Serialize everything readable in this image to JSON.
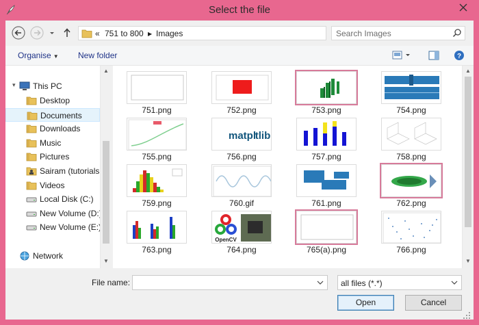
{
  "window": {
    "title": "Select the file"
  },
  "address": {
    "prefix": "«",
    "crumbs": [
      "751 to 800",
      "Images"
    ]
  },
  "search": {
    "placeholder": "Search Images"
  },
  "toolbar": {
    "organise": "Organise",
    "new_folder": "New folder"
  },
  "sidebar": {
    "items": [
      {
        "label": "This PC",
        "icon": "computer-icon",
        "level": 0
      },
      {
        "label": "Desktop",
        "icon": "folder-icon",
        "level": 1
      },
      {
        "label": "Documents",
        "icon": "folder-icon",
        "level": 1,
        "selected": true
      },
      {
        "label": "Downloads",
        "icon": "folder-icon",
        "level": 1
      },
      {
        "label": "Music",
        "icon": "folder-icon",
        "level": 1
      },
      {
        "label": "Pictures",
        "icon": "folder-icon",
        "level": 1
      },
      {
        "label": "Sairam (tutorialsp",
        "icon": "user-folder-icon",
        "level": 1
      },
      {
        "label": "Videos",
        "icon": "folder-icon",
        "level": 1
      },
      {
        "label": "Local Disk (C:)",
        "icon": "drive-icon",
        "level": 1
      },
      {
        "label": "New Volume (D:)",
        "icon": "drive-icon",
        "level": 1
      },
      {
        "label": "New Volume (E:)",
        "icon": "drive-icon",
        "level": 1
      },
      {
        "label": "Network",
        "icon": "network-icon",
        "level": 0
      }
    ]
  },
  "files": [
    {
      "name": "751.png",
      "thumb": "blank-plot"
    },
    {
      "name": "752.png",
      "thumb": "red-square"
    },
    {
      "name": "753.png",
      "thumb": "3d-bars",
      "selected": true
    },
    {
      "name": "754.png",
      "thumb": "blue-panels"
    },
    {
      "name": "755.png",
      "thumb": "green-curve"
    },
    {
      "name": "756.png",
      "thumb": "matplotlib-logo"
    },
    {
      "name": "757.png",
      "thumb": "blue-yellow-bars"
    },
    {
      "name": "758.png",
      "thumb": "3d-surfaces"
    },
    {
      "name": "759.png",
      "thumb": "histogram"
    },
    {
      "name": "760.gif",
      "thumb": "sine-wave"
    },
    {
      "name": "761.png",
      "thumb": "blue-blocks"
    },
    {
      "name": "762.png",
      "thumb": "green-scatter",
      "selected": true
    },
    {
      "name": "763.png",
      "thumb": "grouped-bars"
    },
    {
      "name": "764.png",
      "thumb": "opencv-logo"
    },
    {
      "name": "765(a).png",
      "thumb": "blank-plot",
      "selected": true
    },
    {
      "name": "766.png",
      "thumb": "dot-scatter"
    }
  ],
  "bottom": {
    "file_name_label": "File name:",
    "file_name_value": "",
    "file_type": "all files (*.*)",
    "open": "Open",
    "cancel": "Cancel"
  }
}
